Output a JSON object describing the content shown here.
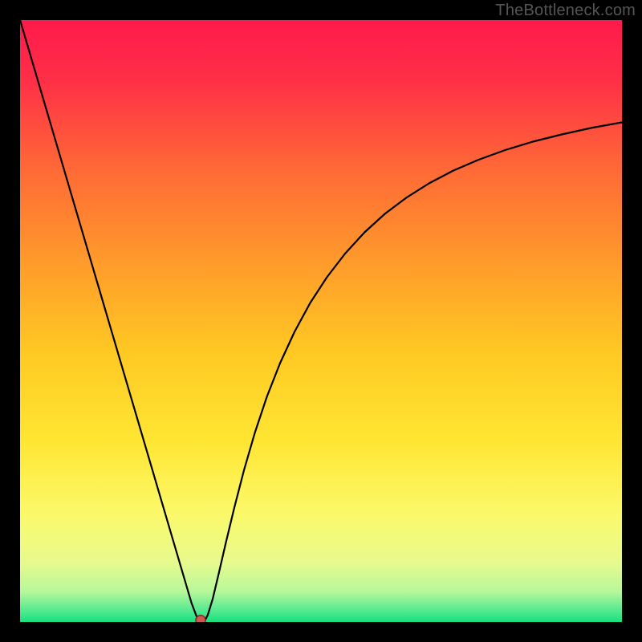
{
  "watermark": "TheBottleneck.com",
  "chart_data": {
    "type": "line",
    "title": "",
    "xlabel": "",
    "ylabel": "",
    "xlim": [
      0,
      100
    ],
    "ylim": [
      0,
      100
    ],
    "gradient_stops": [
      {
        "offset": 0.0,
        "color": "#ff1a4b"
      },
      {
        "offset": 0.1,
        "color": "#ff2f47"
      },
      {
        "offset": 0.25,
        "color": "#ff6a36"
      },
      {
        "offset": 0.4,
        "color": "#ff9a2b"
      },
      {
        "offset": 0.55,
        "color": "#ffc823"
      },
      {
        "offset": 0.7,
        "color": "#ffe633"
      },
      {
        "offset": 0.82,
        "color": "#fbf96a"
      },
      {
        "offset": 0.9,
        "color": "#e8fa8d"
      },
      {
        "offset": 0.95,
        "color": "#b7f79b"
      },
      {
        "offset": 0.983,
        "color": "#4de98f"
      },
      {
        "offset": 1.0,
        "color": "#18e07e"
      }
    ],
    "series": [
      {
        "name": "bottleneck-curve",
        "x": [
          0,
          3,
          6,
          9,
          12,
          15,
          18,
          21,
          24,
          26,
          27.5,
          28.5,
          29.3,
          30.0,
          30.6,
          31.2,
          32.0,
          33.0,
          34.2,
          35.6,
          37.2,
          39.0,
          41.0,
          43.2,
          45.6,
          48.2,
          51.0,
          54.0,
          57.2,
          60.6,
          64.2,
          68.0,
          72.0,
          76.2,
          80.6,
          85.2,
          90.0,
          95.0,
          100.0
        ],
        "y": [
          100.0,
          89.8,
          79.6,
          69.4,
          59.2,
          49.0,
          38.8,
          28.6,
          18.4,
          11.6,
          6.5,
          3.1,
          1.0,
          0.0,
          0.0,
          1.2,
          3.8,
          8.0,
          13.2,
          19.0,
          25.2,
          31.4,
          37.4,
          43.0,
          48.2,
          53.0,
          57.3,
          61.2,
          64.7,
          67.8,
          70.5,
          72.9,
          75.0,
          76.8,
          78.4,
          79.8,
          81.0,
          82.1,
          83.0
        ]
      }
    ],
    "marker": {
      "x": 30.0,
      "y": 0.3,
      "r": 6,
      "fill": "#d05a52",
      "stroke": "#7a2e2a"
    },
    "curve_stroke": "#000000",
    "curve_width": 2.2
  }
}
